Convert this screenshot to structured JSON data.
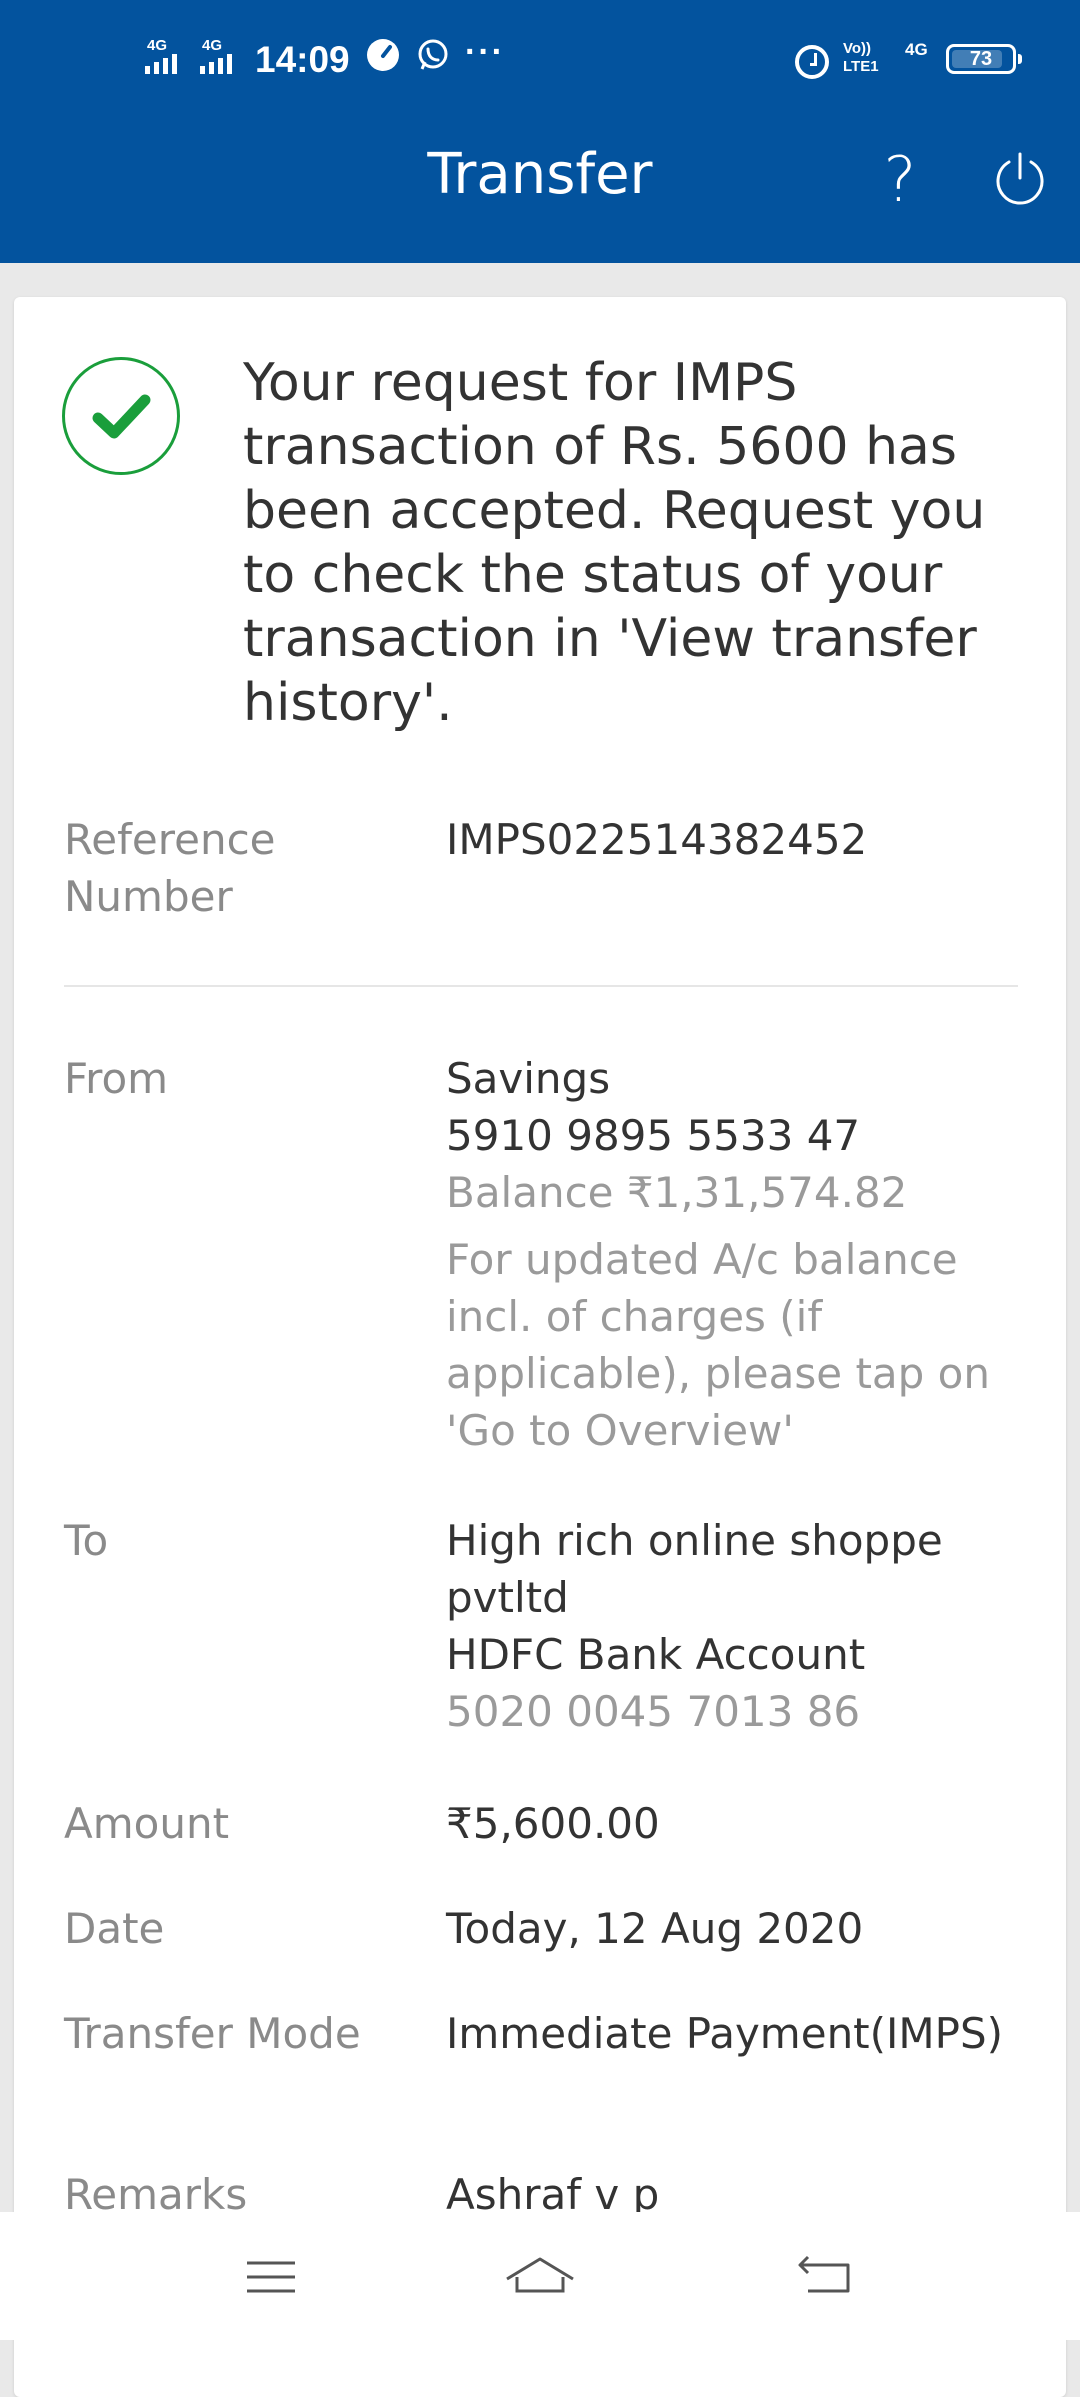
{
  "status_bar": {
    "sim1": "4G",
    "sim2": "4G",
    "time": "14:09",
    "more": "···",
    "volte_top": "Vo))",
    "volte_bottom": "LTE1",
    "network": "4G",
    "battery": "73"
  },
  "header": {
    "title": "Transfer",
    "help_label": "?",
    "background_color": "#03539e"
  },
  "confirmation": {
    "message": "Your request for IMPS transaction of Rs. 5600 has been accepted. Request you to check the status of your transaction in 'View transfer history'.",
    "icon": "check-circle-icon",
    "accent_color": "#1a9e3b"
  },
  "details": {
    "reference": {
      "label": "Reference Number",
      "value": "IMPS022514382452"
    },
    "from": {
      "label": "From",
      "account_type": "Savings",
      "account_number": "5910 9895 5533 47",
      "balance": "Balance ₹1,31,574.82",
      "note": "For updated A/c balance incl. of charges (if applicable), please tap on 'Go to Overview'"
    },
    "to": {
      "label": "To",
      "name": "High rich online shoppe pvtltd",
      "bank": "HDFC Bank Account",
      "account_number": "5020 0045 7013 86"
    },
    "amount": {
      "label": "Amount",
      "value": "₹5,600.00"
    },
    "date": {
      "label": "Date",
      "value": "Today, 12 Aug 2020"
    },
    "transfer_mode": {
      "label": "Transfer Mode",
      "value": "Immediate Payment(IMPS)"
    },
    "remarks": {
      "label": "Remarks",
      "value": "Ashraf v p"
    }
  },
  "navigation": {
    "menu": "menu-icon",
    "home": "home-icon",
    "back": "back-icon"
  }
}
